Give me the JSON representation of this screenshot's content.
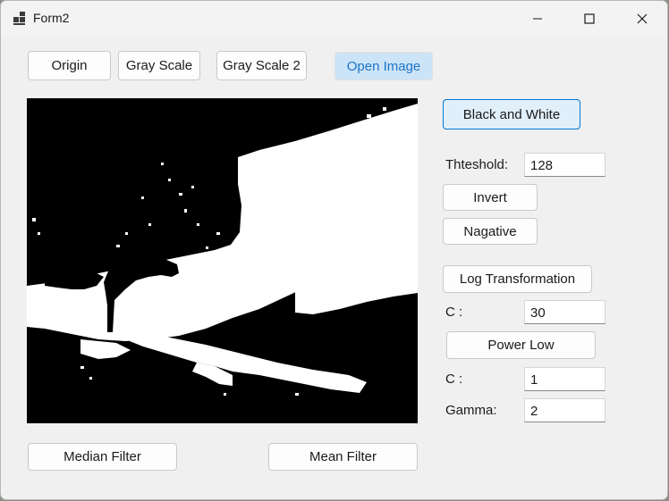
{
  "window": {
    "title": "Form2"
  },
  "toolbar": {
    "origin": "Origin",
    "gray_scale": "Gray Scale",
    "gray_scale_2": "Gray Scale 2",
    "open_image": "Open Image"
  },
  "controls": {
    "black_and_white": "Black and White",
    "threshold_label": "Thteshold:",
    "threshold_value": "128",
    "invert": "Invert",
    "negative": "Nagative",
    "log_transformation": "Log Transformation",
    "log_c_label": "C :",
    "log_c_value": "30",
    "power_low": "Power Low",
    "power_c_label": "C :",
    "power_c_value": "1",
    "gamma_label": "Gamma:",
    "gamma_value": "2"
  },
  "filters": {
    "median": "Median Filter",
    "mean": "Mean Filter"
  },
  "colors": {
    "accent": "#0078d4",
    "highlight_bg": "#cce4f7",
    "window_bg": "#f0f0f0"
  }
}
